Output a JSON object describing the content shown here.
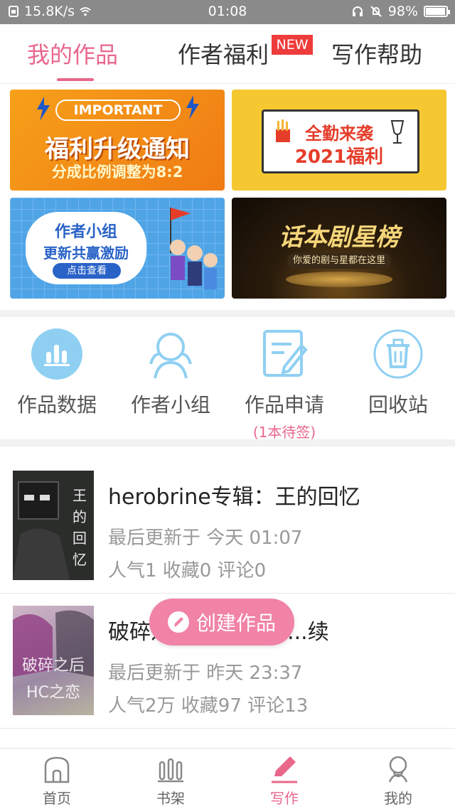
{
  "status_bar": {
    "net_speed": "15.8K/s",
    "time": "01:08",
    "battery": "98%",
    "battery_level": 0.98
  },
  "tabs": [
    {
      "label": "我的作品",
      "active": true
    },
    {
      "label": "作者福利",
      "badge": "NEW"
    },
    {
      "label": "写作帮助"
    }
  ],
  "banners": {
    "b1": {
      "tag": "IMPORTANT",
      "title": "福利升级通知",
      "subtitle": "分成比例调整为8:2"
    },
    "b2": {
      "title": "全勤来袭",
      "subtitle": "2021福利"
    },
    "b3": {
      "title": "作者小组",
      "subtitle": "更新共赢激励",
      "button": "点击查看"
    },
    "b4": {
      "title": "话本剧星榜",
      "subtitle": "你爱的剧与星都在这里"
    }
  },
  "actions": [
    {
      "label": "作品数据",
      "icon": "bar-chart-icon"
    },
    {
      "label": "作者小组",
      "icon": "people-icon"
    },
    {
      "label": "作品申请",
      "icon": "edit-form-icon",
      "sub": "(1本待签)"
    },
    {
      "label": "回收站",
      "icon": "trash-icon"
    }
  ],
  "works": [
    {
      "title": "herobrine专辑：王的回忆",
      "updated": "最后更新于 今天 01:07",
      "stats": "人气1 收藏0 评论0",
      "cover_text": "王的回忆"
    },
    {
      "title": "破碎之后HC之恋......续",
      "updated": "最后更新于 昨天 23:37",
      "stats": "人气2万 收藏97 评论13",
      "cover_text_1": "破碎之后",
      "cover_text_2": "HC之恋"
    }
  ],
  "create_button": {
    "label": "创建作品"
  },
  "bottom_nav": [
    {
      "label": "首页",
      "icon": "home-icon"
    },
    {
      "label": "书架",
      "icon": "bookshelf-icon"
    },
    {
      "label": "写作",
      "icon": "pencil-icon",
      "active": true
    },
    {
      "label": "我的",
      "icon": "profile-icon"
    }
  ],
  "colors": {
    "accent": "#e9678b",
    "create_button": "#f183a6",
    "action_icon": "#8fd0f2",
    "badge": "#ee3b3b"
  }
}
